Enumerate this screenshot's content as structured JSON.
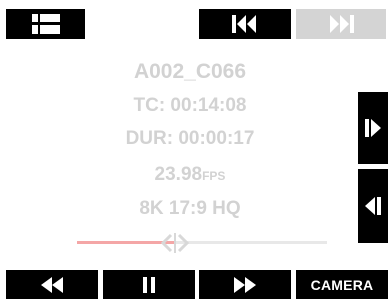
{
  "top_bar": {
    "menu_icon": "list-menu-icon",
    "prev_clip_icon": "skip-previous-icon",
    "next_clip_icon": "skip-next-icon",
    "next_clip_enabled": false
  },
  "clip": {
    "name": "A002_C066",
    "timecode": "TC: 00:14:08",
    "duration": "DUR: 00:00:17",
    "fps_value": "23.98",
    "fps_unit": "FPS",
    "format": "8K 17:9 HQ"
  },
  "scrubber": {
    "progress": 0.39,
    "played_color": "#f4a6a6",
    "track_color": "#e8e8e8"
  },
  "side_controls": {
    "step_forward_icon": "frame-step-forward-icon",
    "step_back_icon": "frame-step-back-icon"
  },
  "transport": {
    "rewind_icon": "rewind-icon",
    "pause_icon": "pause-icon",
    "fast_forward_icon": "fast-forward-icon",
    "camera_label": "CAMERA"
  }
}
